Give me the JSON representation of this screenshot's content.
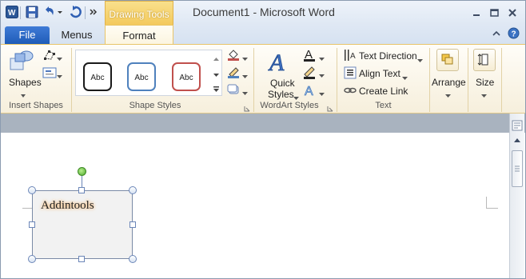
{
  "window": {
    "doc_title": "Document1  -  Microsoft Word",
    "contextual_tab": "Drawing Tools"
  },
  "tabs": {
    "file": "File",
    "menus": "Menus",
    "format": "Format"
  },
  "ribbon": {
    "insert_shapes": {
      "shapes_label": "Shapes",
      "group_label": "Insert Shapes"
    },
    "shape_styles": {
      "samples": [
        "Abc",
        "Abc",
        "Abc"
      ],
      "sample_colors": [
        "#1a1a1a",
        "#4f81bd",
        "#c0504d"
      ],
      "group_label": "Shape Styles"
    },
    "wordart_styles": {
      "quick_styles_line1": "Quick",
      "quick_styles_line2": "Styles",
      "group_label": "WordArt Styles"
    },
    "text": {
      "text_direction": "Text Direction",
      "align_text": "Align Text",
      "create_link": "Create Link",
      "group_label": "Text"
    },
    "arrange": {
      "label": "Arrange"
    },
    "size": {
      "label": "Size"
    }
  },
  "document": {
    "shape_text": "Addintools"
  },
  "colors": {
    "accent_orange": "#f3c85a",
    "file_tab_blue": "#1f5cb8",
    "ribbon_bg": "#fbf4de"
  }
}
